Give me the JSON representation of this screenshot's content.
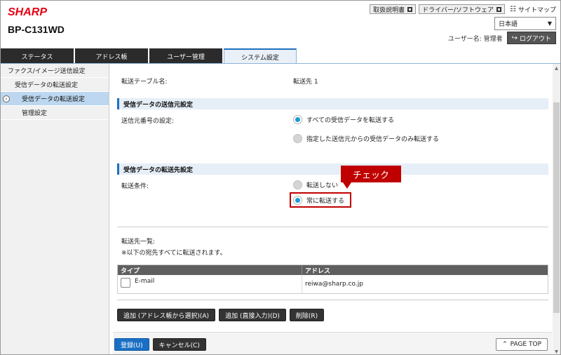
{
  "header": {
    "brand": "SHARP",
    "model": "BP-C131WD",
    "links": [
      {
        "label": "取扱説明書"
      },
      {
        "label": "ドライバー/ソフトウェア"
      }
    ],
    "sitemap_label": "サイトマップ",
    "language": "日本語",
    "user_label": "ユーザー名: 管理者",
    "logout_label": "ログアウト"
  },
  "tabs": [
    {
      "label": "ステータス"
    },
    {
      "label": "アドレス帳"
    },
    {
      "label": "ユーザー管理"
    },
    {
      "label": "システム設定"
    }
  ],
  "sidebar": {
    "items": [
      {
        "label": "ファクス/イメージ送信設定"
      },
      {
        "label": "受信データの転送設定"
      },
      {
        "label": "受信データの転送設定"
      },
      {
        "label": "管理設定"
      }
    ]
  },
  "main": {
    "table_name_label": "転送テーブル名:",
    "table_name_value": "転送先 1",
    "sender_section": "受信データの送信元設定",
    "sender_number_label": "送信元番号の設定:",
    "sender_options": [
      "すべての受信データを転送する",
      "指定した送信元からの受信データのみ転送する"
    ],
    "dest_section": "受信データの転送先設定",
    "condition_label": "転送条件:",
    "condition_options": [
      "転送しない",
      "常に転送する"
    ],
    "callout": "チェック",
    "dest_list_label": "転送先一覧:",
    "dest_list_note": "※以下の宛先すべてに転送されます。",
    "table": {
      "headers": [
        "タイプ",
        "アドレス"
      ],
      "rows": [
        {
          "type": "E-mail",
          "address": "reiwa@sharp.co.jp"
        }
      ]
    },
    "buttons": {
      "add_from_book": "追加 (アドレス帳から選択)(A)",
      "add_direct": "追加 (直接入力)(D)",
      "delete": "削除(R)"
    },
    "footer": {
      "register": "登録(U)",
      "cancel": "キャンセル(C)",
      "page_top": "PAGE TOP"
    }
  },
  "colors": {
    "brand": "#e60012",
    "accent": "#1a9bd7",
    "callout": "#c00000",
    "primary": "#1a6fc4"
  }
}
